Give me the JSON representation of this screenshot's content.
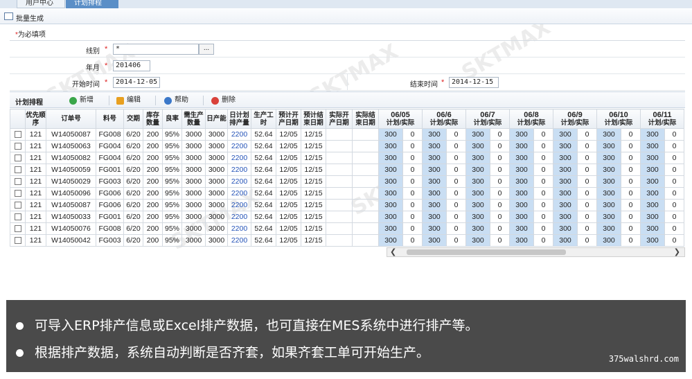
{
  "tabs": [
    "用户中心",
    "计划排程"
  ],
  "toolbar": {
    "batch_label": "批量生成"
  },
  "required_note": "为必填项",
  "form": {
    "line_label": "线别",
    "line_value": "*",
    "line_button": "...",
    "month_label": "年月",
    "month_value": "201406",
    "start_label": "开始时间",
    "start_value": "2014-12-05",
    "end_label": "结束时间",
    "end_value": "2014-12-15"
  },
  "section": {
    "title": "计划排程",
    "add": "新增",
    "edit": "编辑",
    "help": "帮助",
    "delete": "删除",
    "colors": {
      "add": "#3aa64a",
      "edit": "#e8a020",
      "help": "#3b78c9",
      "delete": "#d9413a"
    }
  },
  "grid": {
    "headers": [
      "优先顺序",
      "订单号",
      "料号",
      "交期",
      "库存数量",
      "良率",
      "需生产数量",
      "日产能",
      "日计划排产量",
      "生产工时",
      "预计开产日期",
      "预计结束日期",
      "实际开产日期",
      "实际结束日期"
    ],
    "day_headers": [
      "06/05",
      "06/6",
      "06/7",
      "06/8",
      "06/9",
      "06/10",
      "06/11"
    ],
    "day_sub": "计划/实际",
    "rows": [
      [
        "121",
        "W14050087",
        "FG008",
        "6/20",
        "200",
        "95%",
        "3000",
        "3000",
        "2200",
        "52.64",
        "12/05",
        "12/15",
        "",
        ""
      ],
      [
        "121",
        "W14050063",
        "FG004",
        "6/20",
        "200",
        "95%",
        "3000",
        "3000",
        "2200",
        "52.64",
        "12/05",
        "12/15",
        "",
        ""
      ],
      [
        "121",
        "W14050082",
        "FG004",
        "6/20",
        "200",
        "95%",
        "3000",
        "3000",
        "2200",
        "52.64",
        "12/05",
        "12/15",
        "",
        ""
      ],
      [
        "121",
        "W14050059",
        "FG001",
        "6/20",
        "200",
        "95%",
        "3000",
        "3000",
        "2200",
        "52.64",
        "12/05",
        "12/15",
        "",
        ""
      ],
      [
        "121",
        "W14050029",
        "FG003",
        "6/20",
        "200",
        "95%",
        "3000",
        "3000",
        "2200",
        "52.64",
        "12/05",
        "12/15",
        "",
        ""
      ],
      [
        "121",
        "W14050096",
        "FG006",
        "6/20",
        "200",
        "95%",
        "3000",
        "3000",
        "2200",
        "52.64",
        "12/05",
        "12/15",
        "",
        ""
      ],
      [
        "121",
        "W14050087",
        "FG006",
        "6/20",
        "200",
        "95%",
        "3000",
        "3000",
        "2200",
        "52.64",
        "12/05",
        "12/15",
        "",
        ""
      ],
      [
        "121",
        "W14050033",
        "FG001",
        "6/20",
        "200",
        "95%",
        "3000",
        "3000",
        "2200",
        "52.64",
        "12/05",
        "12/15",
        "",
        ""
      ],
      [
        "121",
        "W14050076",
        "FG008",
        "6/20",
        "200",
        "95%",
        "3000",
        "3000",
        "2200",
        "52.64",
        "12/05",
        "12/15",
        "",
        ""
      ],
      [
        "121",
        "W14050042",
        "FG003",
        "6/20",
        "200",
        "95%",
        "3000",
        "3000",
        "2200",
        "52.64",
        "12/05",
        "12/15",
        "",
        ""
      ]
    ],
    "plan_value": "300",
    "actual_value": "0"
  },
  "banner": {
    "line1": "可导入ERP排产信息或Excel排产数据，也可直接在MES系统中进行排产等。",
    "line2": "根据排产数据，系统自动判断是否齐套，如果齐套工单可开始生产。",
    "site": "375walshrd.com"
  },
  "watermark": "SKTMAX"
}
